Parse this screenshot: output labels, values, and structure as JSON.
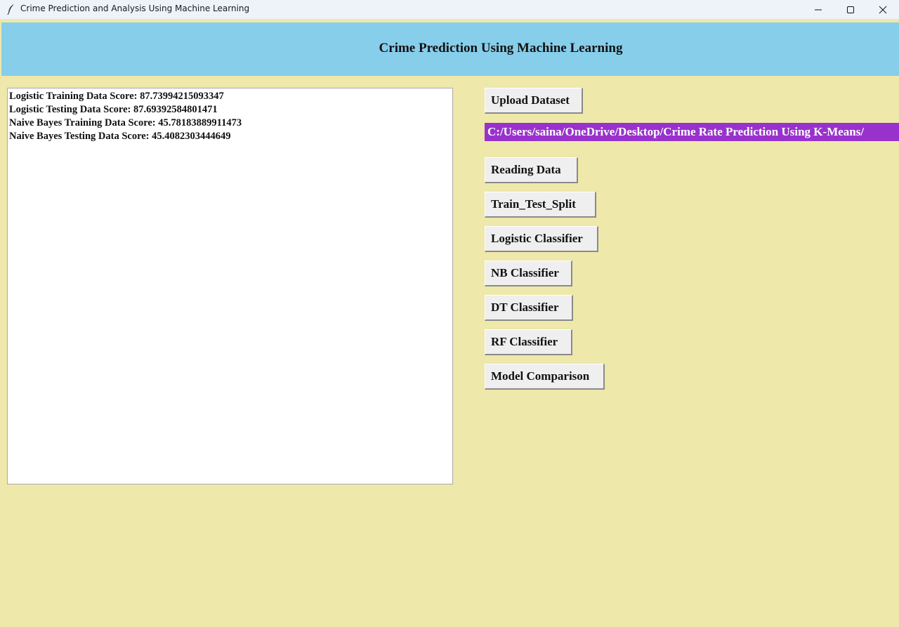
{
  "window": {
    "title": "Crime Prediction and Analysis Using Machine Learning",
    "icon": "feather-icon"
  },
  "header": {
    "title": "Crime Prediction Using Machine Learning"
  },
  "output": {
    "lines": [
      "Logistic Training Data Score: 87.73994215093347",
      "Logistic Testing Data Score: 87.69392584801471",
      "Naive Bayes Training Data Score: 45.78183889911473",
      "Naive Bayes Testing Data Score: 45.4082303444649"
    ]
  },
  "path_label": "C:/Users/saina/OneDrive/Desktop/Crime Rate Prediction Using K-Means/",
  "buttons": {
    "upload": "Upload Dataset",
    "reading": "Reading Data",
    "split": "Train_Test_Split",
    "logistic": "Logistic Classifier",
    "nb": "NB Classifier",
    "dt": "DT Classifier",
    "rf": "RF Classifier",
    "comparison": "Model Comparison"
  },
  "colors": {
    "background": "#eee8aa",
    "header": "#87ceeb",
    "path_label": "#9932cc",
    "button": "#efefef"
  }
}
